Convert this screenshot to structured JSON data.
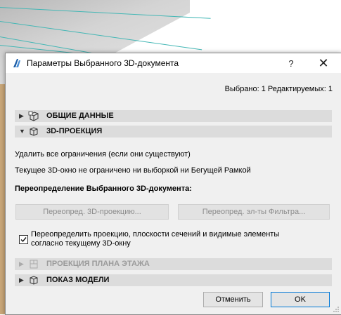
{
  "window": {
    "title": "Параметры Выбранного 3D-документа",
    "help_label": "?",
    "close_label": "✕"
  },
  "status": "Выбрано: 1 Редактируемых: 1",
  "sections": {
    "general": {
      "label": "ОБЩИЕ ДАННЫЕ",
      "arrow": "▶"
    },
    "projection": {
      "label": "3D-ПРОЕКЦИЯ",
      "arrow": "▼"
    },
    "floor_plan": {
      "label": "ПРОЕКЦИЯ ПЛАНА ЭТАЖА",
      "arrow": "▶"
    },
    "model": {
      "label": "ПОКАЗ МОДЕЛИ",
      "arrow": "▶"
    }
  },
  "projection_panel": {
    "remove_limits": "Удалить все ограничения (если они существуют)",
    "current_info": "Текущее 3D-окно не ограничено ни выборкой ни Бегущей Рамкой",
    "override_heading": "Переопределение Выбранного 3D-документа:",
    "override_projection_btn": "Переопред. 3D-проекцию...",
    "override_filter_btn": "Переопред. эл-ты Фильтра...",
    "checkbox_label": "Переопределить проекцию, плоскости сечений и видимые элементы согласно текущему 3D-окну",
    "checkbox_checked": true
  },
  "footer": {
    "cancel_label": "Отменить",
    "ok_label": "OK"
  },
  "colors": {
    "accent": "#0078d7",
    "section_bg": "#dcdcdc",
    "dialog_bg": "#f0f0f0"
  }
}
